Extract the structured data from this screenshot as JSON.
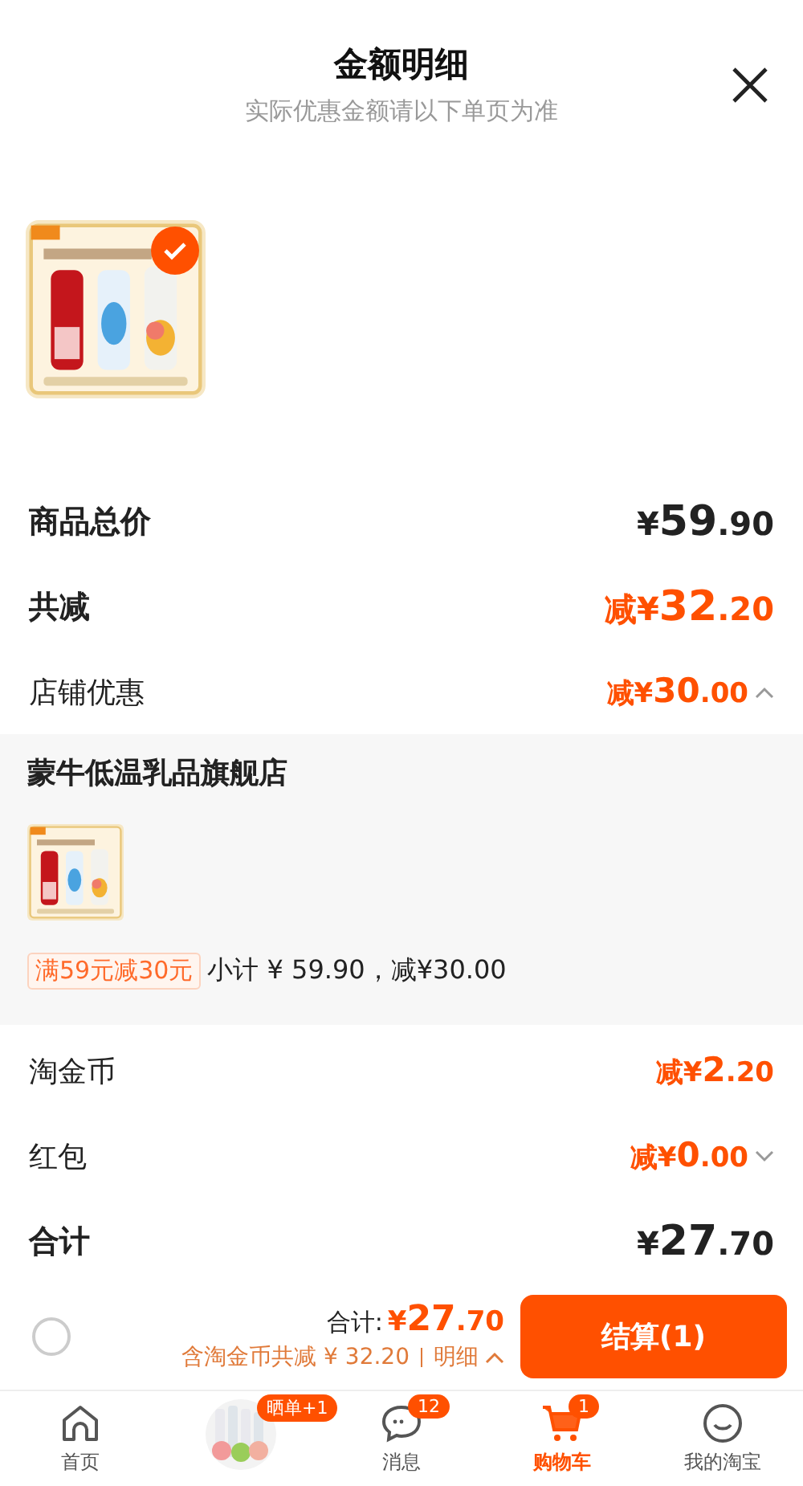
{
  "header": {
    "title": "金额明细",
    "subtitle": "实际优惠金额请以下单页为准"
  },
  "product": {
    "kind": "picture",
    "selected": true
  },
  "rows": [
    {
      "kind": "sum",
      "label": "商品总价",
      "price": {
        "prefix": "¥",
        "main": "59",
        "fraction": ".90"
      }
    },
    {
      "kind": "deduction_sum",
      "label": "共减",
      "price": {
        "prefix": "减¥",
        "main": "32",
        "fraction": ".20"
      }
    },
    {
      "kind": "deduction",
      "label": "店铺优惠",
      "expanded": true,
      "price": {
        "prefix": "减¥",
        "main": "30",
        "fraction": ".00"
      }
    }
  ],
  "store": {
    "name": "蒙牛低温乳品旗舰店",
    "product": {
      "kind": "picture"
    },
    "tag": "满59元减30元",
    "summary": "小计 ¥ 59.90，减¥30.00"
  },
  "rows_after": [
    {
      "kind": "deduction",
      "label": "淘金币",
      "price": {
        "prefix": "减¥",
        "main": "2",
        "fraction": ".20"
      }
    },
    {
      "kind": "deduction",
      "label": "红包",
      "expanded": false,
      "price": {
        "prefix": "减¥",
        "main": "0",
        "fraction": ".00"
      }
    },
    {
      "kind": "sum",
      "label": "合计",
      "price": {
        "prefix": "¥",
        "main": "27",
        "fraction": ".70"
      }
    }
  ],
  "checkout": {
    "select_all": false,
    "total_label": "合计:",
    "total": {
      "prefix": "¥",
      "main": "27",
      "fraction": ".70"
    },
    "savings": "含淘金币共减 ¥ 32.20",
    "detail_link": "明细",
    "button": "结算(1)"
  },
  "tabbar": [
    {
      "kind": "home",
      "label": "首页",
      "selected": false
    },
    {
      "kind": "picture",
      "badge": "晒单+1",
      "selected": false
    },
    {
      "kind": "message",
      "label": "消息",
      "badge": "12",
      "selected": false
    },
    {
      "kind": "cart",
      "label": "购物车",
      "badge": "1",
      "selected": true
    },
    {
      "kind": "smile",
      "label": "我的淘宝",
      "selected": false
    }
  ]
}
